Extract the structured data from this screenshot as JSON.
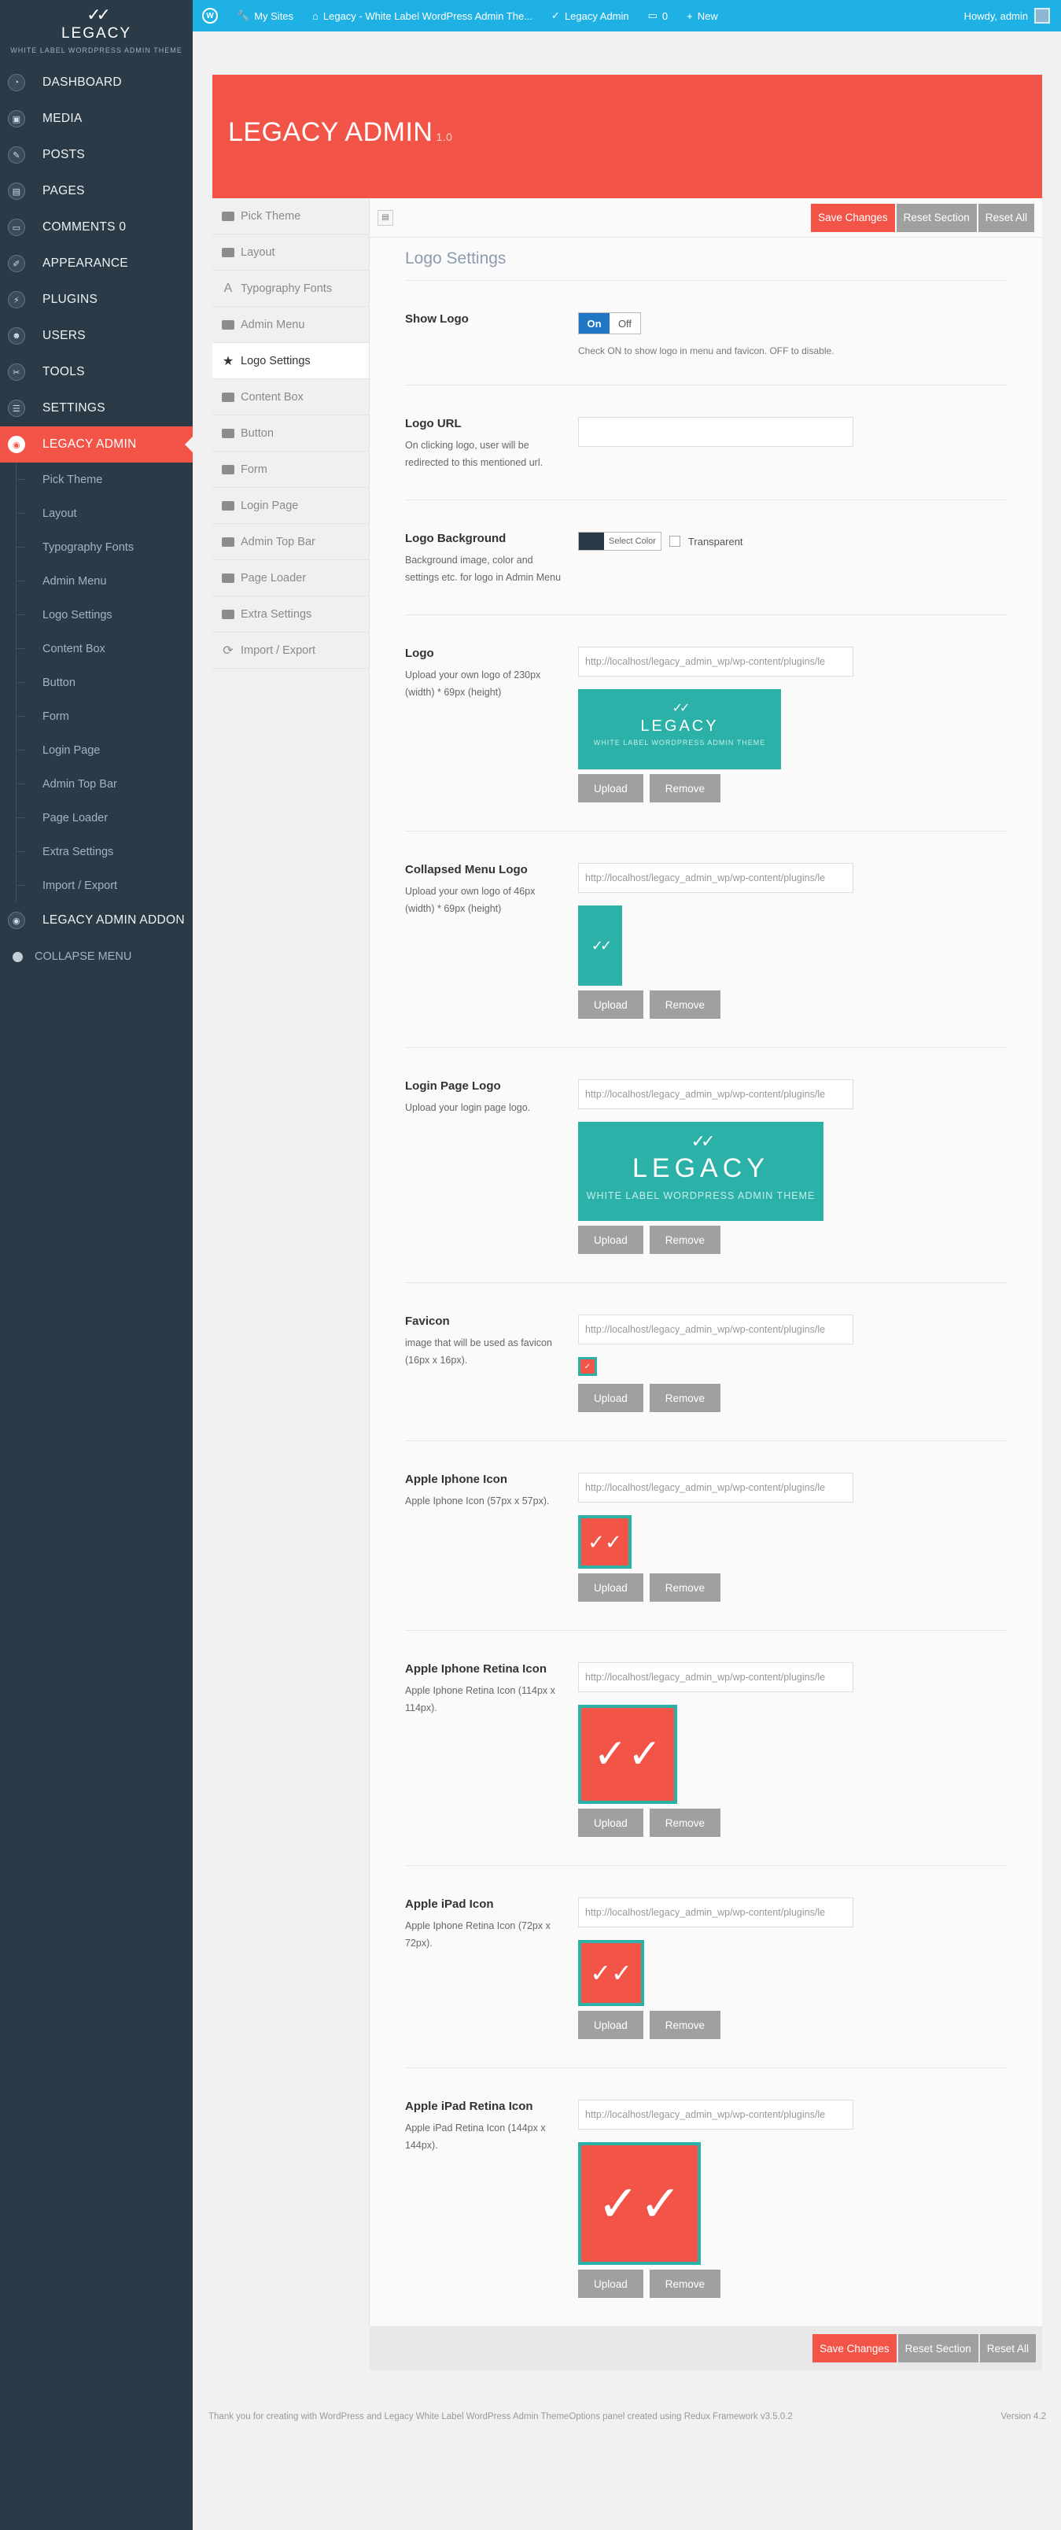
{
  "brand": {
    "mark": "✓✓",
    "name": "LEGACY",
    "tagline": "WHITE LABEL WORDPRESS ADMIN THEME"
  },
  "sidebar": {
    "items": [
      {
        "label": "DASHBOARD",
        "icon": "dashboard-icon"
      },
      {
        "label": "MEDIA",
        "icon": "media-icon"
      },
      {
        "label": "POSTS",
        "icon": "posts-icon"
      },
      {
        "label": "PAGES",
        "icon": "pages-icon"
      },
      {
        "label": "COMMENTS 0",
        "icon": "comments-icon"
      },
      {
        "label": "APPEARANCE",
        "icon": "appearance-icon"
      },
      {
        "label": "PLUGINS",
        "icon": "plugins-icon"
      },
      {
        "label": "USERS",
        "icon": "users-icon"
      },
      {
        "label": "TOOLS",
        "icon": "tools-icon"
      },
      {
        "label": "SETTINGS",
        "icon": "settings-icon"
      },
      {
        "label": "LEGACY ADMIN",
        "icon": "legacy-admin-icon"
      }
    ],
    "submenu": [
      "Pick Theme",
      "Layout",
      "Typography Fonts",
      "Admin Menu",
      "Logo Settings",
      "Content Box",
      "Button",
      "Form",
      "Login Page",
      "Admin Top Bar",
      "Page Loader",
      "Extra Settings",
      "Import / Export"
    ],
    "addon": "LEGACY ADMIN ADDON",
    "collapse": "COLLAPSE MENU"
  },
  "adminbar": {
    "my_sites": "My Sites",
    "site": "Legacy - White Label WordPress Admin The...",
    "legacy_admin": "Legacy Admin",
    "comments": "0",
    "new": "New",
    "howdy": "Howdy, admin"
  },
  "header": {
    "title": "LEGACY ADMIN",
    "version": "1.0"
  },
  "tabs": [
    "Pick Theme",
    "Layout",
    "Typography Fonts",
    "Admin Menu",
    "Logo Settings",
    "Content Box",
    "Button",
    "Form",
    "Login Page",
    "Admin Top Bar",
    "Page Loader",
    "Extra Settings",
    "Import / Export"
  ],
  "toolbar": {
    "save": "Save Changes",
    "reset_section": "Reset Section",
    "reset_all": "Reset All"
  },
  "section_title": "Logo Settings",
  "fields": {
    "show_logo": {
      "title": "Show Logo",
      "on": "On",
      "off": "Off",
      "hint": "Check ON to show logo in menu and favicon. OFF to disable."
    },
    "logo_url": {
      "title": "Logo URL",
      "desc": "On clicking logo, user will be redirected to this mentioned url.",
      "value": ""
    },
    "logo_bg": {
      "title": "Logo Background",
      "desc": "Background image, color and settings etc. for logo in Admin Menu",
      "select_color": "Select Color",
      "transparent": "Transparent",
      "color": "#2b3a47"
    },
    "logo": {
      "title": "Logo",
      "desc": "Upload your own logo of 230px (width) * 69px (height)",
      "value": "http://localhost/legacy_admin_wp/wp-content/plugins/le"
    },
    "collapsed_logo": {
      "title": "Collapsed Menu Logo",
      "desc": "Upload your own logo of 46px (width) * 69px (height)",
      "value": "http://localhost/legacy_admin_wp/wp-content/plugins/le"
    },
    "login_logo": {
      "title": "Login Page Logo",
      "desc": "Upload your login page logo.",
      "value": "http://localhost/legacy_admin_wp/wp-content/plugins/le"
    },
    "favicon": {
      "title": "Favicon",
      "desc": "image that will be used as favicon (16px x 16px).",
      "value": "http://localhost/legacy_admin_wp/wp-content/plugins/le"
    },
    "iphone": {
      "title": "Apple Iphone Icon",
      "desc": "Apple Iphone Icon (57px x 57px).",
      "value": "http://localhost/legacy_admin_wp/wp-content/plugins/le"
    },
    "iphone_retina": {
      "title": "Apple Iphone Retina Icon",
      "desc": "Apple Iphone Retina Icon (114px x 114px).",
      "value": "http://localhost/legacy_admin_wp/wp-content/plugins/le"
    },
    "ipad": {
      "title": "Apple iPad Icon",
      "desc": "Apple Iphone Retina Icon (72px x 72px).",
      "value": "http://localhost/legacy_admin_wp/wp-content/plugins/le"
    },
    "ipad_retina": {
      "title": "Apple iPad Retina Icon",
      "desc": "Apple iPad Retina Icon (144px x 144px).",
      "value": "http://localhost/legacy_admin_wp/wp-content/plugins/le"
    }
  },
  "upload": "Upload",
  "remove": "Remove",
  "footer": {
    "t1": "Thank you for creating with ",
    "wordpress": "WordPress",
    "t2": " and ",
    "legacy": "Legacy White Label WordPress Admin Theme",
    "t3": "Options panel created using ",
    "redux": "Redux Framework",
    "t4": " v3.5.0.2",
    "version": "Version 4.2"
  },
  "colors": {
    "accent": "#f25448",
    "sidebar": "#2b3a47",
    "adminbar": "#1fb1e4",
    "teal": "#2bb1a8",
    "switch_on": "#1f77c5"
  }
}
